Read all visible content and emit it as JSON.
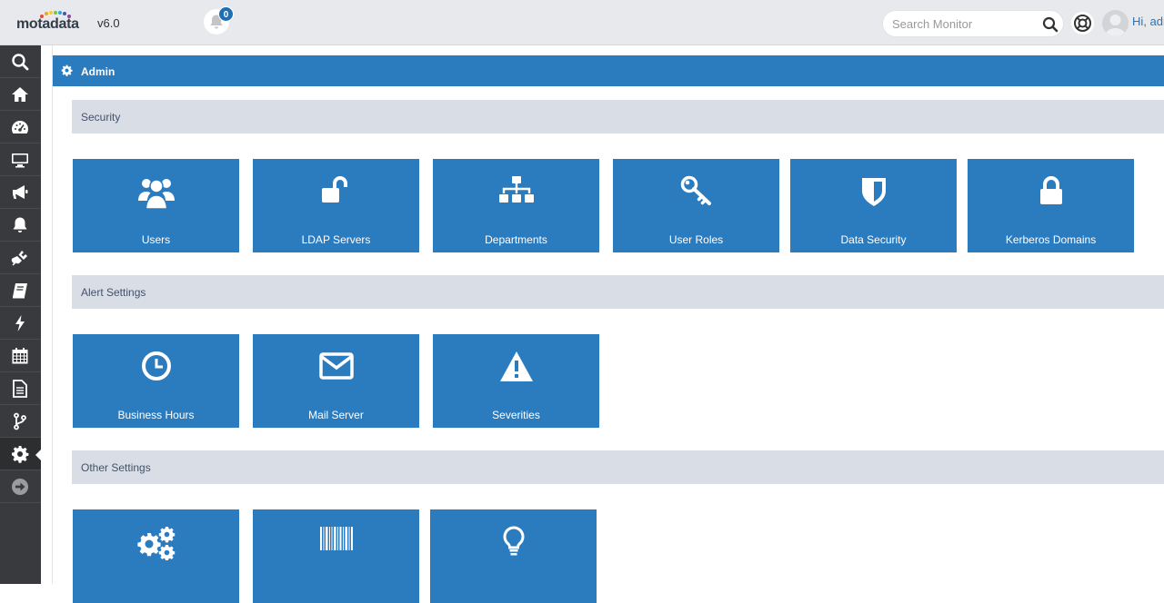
{
  "header": {
    "logo_text": "motadata",
    "version": "v6.0",
    "notification_count": "0",
    "search_placeholder": "Search Monitor",
    "greeting": "Hi, adm"
  },
  "sidebar": {
    "items": [
      {
        "name": "search-icon"
      },
      {
        "name": "home-icon"
      },
      {
        "name": "dashboard-icon"
      },
      {
        "name": "monitor-icon"
      },
      {
        "name": "megaphone-icon"
      },
      {
        "name": "alarm-bell-icon"
      },
      {
        "name": "plug-icon"
      },
      {
        "name": "book-icon"
      },
      {
        "name": "bolt-icon"
      },
      {
        "name": "calendar-icon"
      },
      {
        "name": "report-icon"
      },
      {
        "name": "branch-icon"
      },
      {
        "name": "gear-icon",
        "active": true
      },
      {
        "name": "arrow-right-icon"
      }
    ]
  },
  "page": {
    "title": "Admin"
  },
  "sections": [
    {
      "title": "Security",
      "tiles": [
        {
          "label": "Users",
          "icon": "users-icon"
        },
        {
          "label": "LDAP Servers",
          "icon": "unlock-icon"
        },
        {
          "label": "Departments",
          "icon": "sitemap-icon"
        },
        {
          "label": "User Roles",
          "icon": "key-icon"
        },
        {
          "label": "Data Security",
          "icon": "shield-icon"
        },
        {
          "label": "Kerberos Domains",
          "icon": "lock-icon"
        }
      ]
    },
    {
      "title": "Alert Settings",
      "tiles": [
        {
          "label": "Business Hours",
          "icon": "clock-icon"
        },
        {
          "label": "Mail Server",
          "icon": "envelope-icon"
        },
        {
          "label": "Severities",
          "icon": "warning-icon"
        }
      ]
    },
    {
      "title": "Other Settings",
      "tiles": [
        {
          "label": "",
          "icon": "gears-icon"
        },
        {
          "label": "",
          "icon": "barcode-icon"
        },
        {
          "label": "",
          "icon": "lightbulb-icon"
        }
      ]
    }
  ],
  "colors": {
    "accent": "#2b7bbf",
    "sidebar": "#393a3d",
    "section_bg": "#d8dde6"
  }
}
